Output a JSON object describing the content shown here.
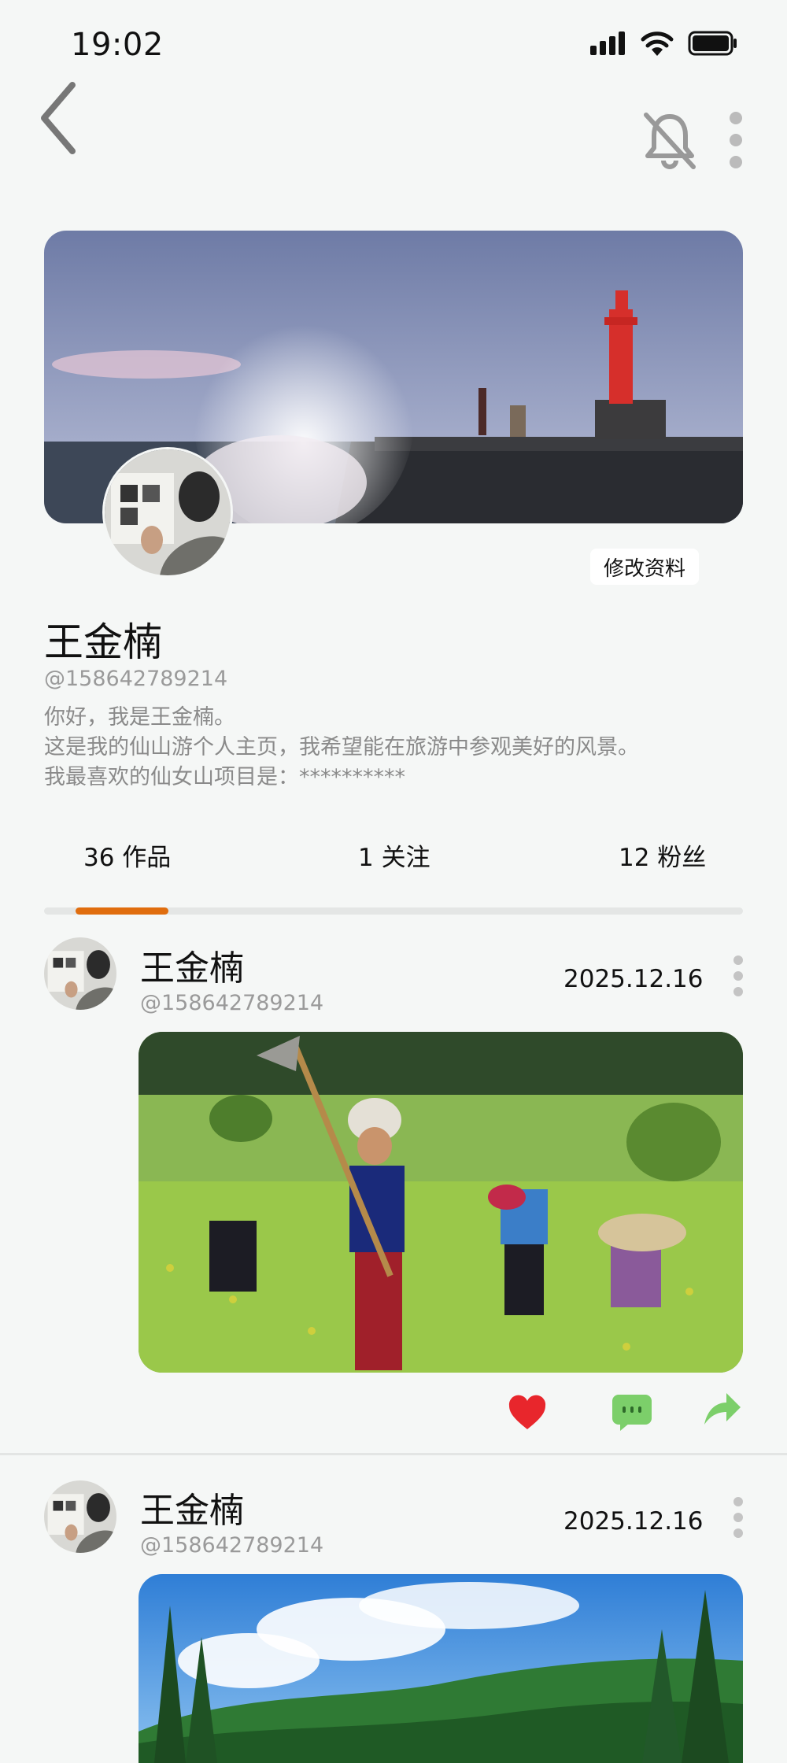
{
  "status_bar": {
    "time": "19:02"
  },
  "profile": {
    "edit_label": "修改资料",
    "name": "王金楠",
    "handle": "@158642789214",
    "bio": [
      "你好，我是王金楠。",
      "这是我的仙山游个人主页，我希望能在旅游中参观美好的风景。",
      "我最喜欢的仙女山项目是：**********"
    ]
  },
  "stats": {
    "works": "36 作品",
    "following": "1 关注",
    "followers": "12 粉丝"
  },
  "posts": [
    {
      "name": "王金楠",
      "handle": "@158642789214",
      "date": "2025.12.16"
    },
    {
      "name": "王金楠",
      "handle": "@158642789214",
      "date": "2025.12.16"
    }
  ],
  "colors": {
    "accent": "#e06d0e",
    "like": "#e8262c",
    "comment": "#7ccf6a",
    "share": "#7ccf6a"
  }
}
